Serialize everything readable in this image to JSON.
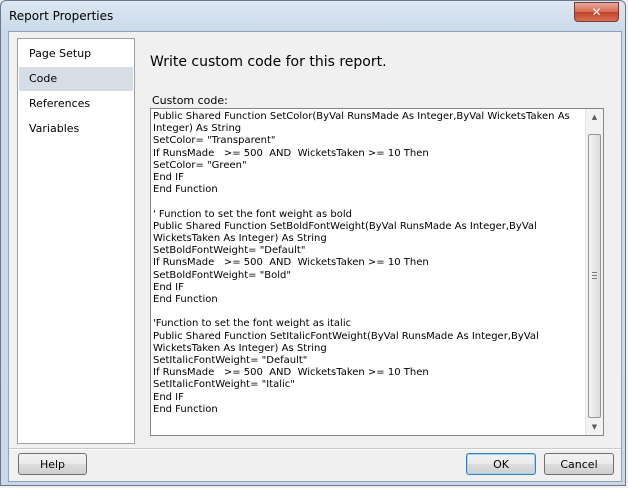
{
  "window": {
    "title": "Report Properties",
    "close_icon": "close-icon"
  },
  "sidebar": {
    "items": [
      {
        "label": "Page Setup",
        "selected": false
      },
      {
        "label": "Code",
        "selected": true
      },
      {
        "label": "References",
        "selected": false
      },
      {
        "label": "Variables",
        "selected": false
      }
    ]
  },
  "main": {
    "heading": "Write custom code for this report.",
    "code_label": "Custom code:",
    "code": "Public Shared Function SetColor(ByVal RunsMade As Integer,ByVal WicketsTaken As Integer) As String\nSetColor= \"Transparent\"\nIf RunsMade   >= 500  AND  WicketsTaken >= 10 Then\nSetColor= \"Green\"\nEnd IF\nEnd Function\n\n' Function to set the font weight as bold\nPublic Shared Function SetBoldFontWeight(ByVal RunsMade As Integer,ByVal WicketsTaken As Integer) As String\nSetBoldFontWeight= \"Default\"\nIf RunsMade   >= 500  AND  WicketsTaken >= 10 Then\nSetBoldFontWeight= \"Bold\"\nEnd IF\nEnd Function\n\n'Function to set the font weight as italic\nPublic Shared Function SetItalicFontWeight(ByVal RunsMade As Integer,ByVal WicketsTaken As Integer) As String\nSetItalicFontWeight= \"Default\"\nIf RunsMade   >= 500  AND  WicketsTaken >= 10 Then\nSetItalicFontWeight= \"Italic\"\nEnd IF\nEnd Function"
  },
  "buttons": {
    "help": "Help",
    "ok": "OK",
    "cancel": "Cancel"
  },
  "colors": {
    "selected_bg": "#d7dde6",
    "window_frame": "#c9d7e8",
    "close_red": "#c0432a"
  }
}
